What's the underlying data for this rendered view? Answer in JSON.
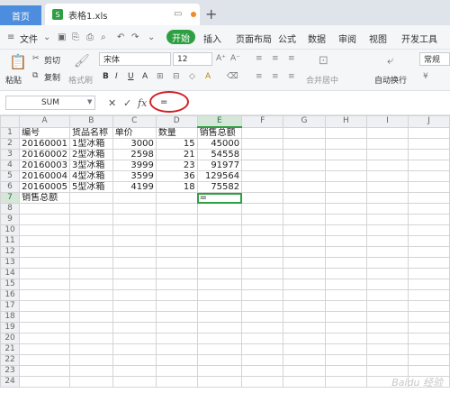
{
  "tabs": {
    "home": "首页",
    "document": "表格1.xls",
    "file_icon": "S"
  },
  "menu": {
    "file": "文件",
    "start": "开始",
    "items": [
      "插入",
      "页面布局",
      "公式",
      "数据",
      "审阅",
      "视图",
      "开发工具"
    ]
  },
  "ribbon": {
    "paste": "粘贴",
    "cut": "剪切",
    "copy": "复制",
    "format_painter": "格式刷",
    "font_name": "宋体",
    "font_size": "12",
    "merge_center": "合并居中",
    "wrap_text": "自动换行",
    "number_format": "常规"
  },
  "formula_bar": {
    "name_box": "SUM",
    "value": "="
  },
  "sheet": {
    "columns": [
      "A",
      "B",
      "C",
      "D",
      "E",
      "F",
      "G",
      "H",
      "I",
      "J"
    ],
    "rows": [
      [
        "编号",
        "货品名称",
        "单价",
        "数量",
        "销售总额",
        "",
        "",
        "",
        "",
        ""
      ],
      [
        "20160001",
        "1型冰箱",
        "3000",
        "15",
        "45000",
        "",
        "",
        "",
        "",
        ""
      ],
      [
        "20160002",
        "2型冰箱",
        "2598",
        "21",
        "54558",
        "",
        "",
        "",
        "",
        ""
      ],
      [
        "20160003",
        "3型冰箱",
        "3999",
        "23",
        "91977",
        "",
        "",
        "",
        "",
        ""
      ],
      [
        "20160004",
        "4型冰箱",
        "3599",
        "36",
        "129564",
        "",
        "",
        "",
        "",
        ""
      ],
      [
        "20160005",
        "5型冰箱",
        "4199",
        "18",
        "75582",
        "",
        "",
        "",
        "",
        ""
      ],
      [
        "销售总额",
        "",
        "",
        "",
        "=",
        "",
        "",
        "",
        "",
        ""
      ]
    ],
    "total_rows": 24,
    "active_cell": "E7"
  },
  "watermark": "Baidu 经验"
}
